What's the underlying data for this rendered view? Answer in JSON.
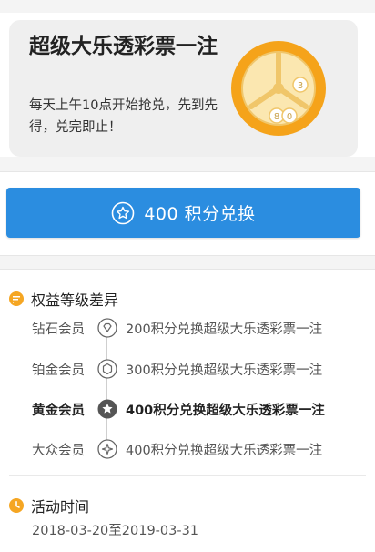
{
  "prize": {
    "title": "超级大乐透彩票一注",
    "description": "每天上午10点开始抢兑，先到先得，兑完即止！",
    "art_icon": "lottery-wheel-icon",
    "art_balls": [
      "3",
      "8",
      "0"
    ]
  },
  "redeem": {
    "label": "400 积分兑换",
    "icon": "star-icon",
    "color": "#2b8de0"
  },
  "benefits": {
    "title": "权益等级差异",
    "icon": "message-icon",
    "accent": "#f5a623",
    "levels": [
      {
        "name": "钻石会员",
        "desc": "200积分兑换超级大乐透彩票一注",
        "icon": "diamond-icon",
        "active": false
      },
      {
        "name": "铂金会员",
        "desc": "300积分兑换超级大乐透彩票一注",
        "icon": "hexagon-icon",
        "active": false
      },
      {
        "name": "黄金会员",
        "desc": "400积分兑换超级大乐透彩票一注",
        "icon": "star-icon",
        "active": true
      },
      {
        "name": "大众会员",
        "desc": "400积分兑换超级大乐透彩票一注",
        "icon": "sparkle-icon",
        "active": false
      }
    ]
  },
  "activity": {
    "title": "活动时间",
    "icon": "clock-icon",
    "range": "2018-03-20至2019-03-31"
  }
}
